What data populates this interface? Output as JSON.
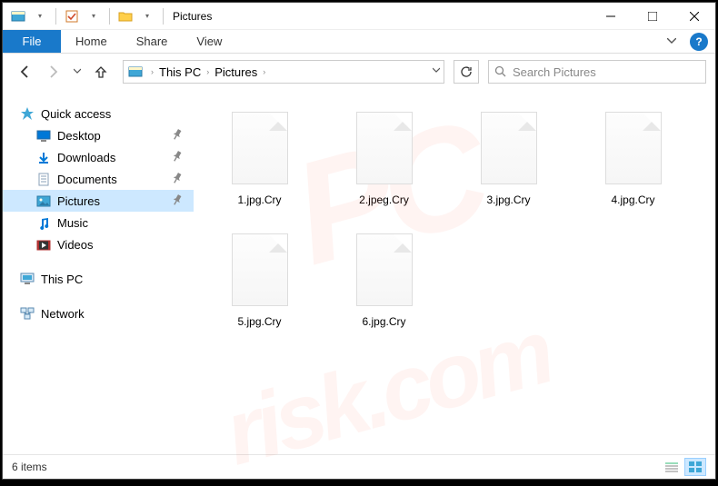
{
  "window": {
    "title": "Pictures",
    "controls": {
      "minimize": "—",
      "maximize": "☐",
      "close": "✕"
    }
  },
  "ribbon": {
    "file": "File",
    "tabs": [
      "Home",
      "Share",
      "View"
    ],
    "help": "?"
  },
  "nav": {
    "back": "←",
    "forward": "→",
    "recent": "˅",
    "up": "↑",
    "address_dropdown": "˅",
    "refresh": "↻"
  },
  "address": {
    "segments": [
      "This PC",
      "Pictures"
    ]
  },
  "search": {
    "placeholder": "Search Pictures"
  },
  "sidebar": {
    "quick_access": {
      "label": "Quick access",
      "items": [
        {
          "label": "Desktop",
          "icon": "desktop",
          "color": "#0078d7",
          "pinned": true
        },
        {
          "label": "Downloads",
          "icon": "downloads",
          "color": "#0078d7",
          "pinned": true
        },
        {
          "label": "Documents",
          "icon": "documents",
          "color": "#8aa0b8",
          "pinned": true
        },
        {
          "label": "Pictures",
          "icon": "pictures",
          "color": "#3fa7d6",
          "pinned": true,
          "selected": true
        },
        {
          "label": "Music",
          "icon": "music",
          "color": "#0078d7",
          "pinned": false
        },
        {
          "label": "Videos",
          "icon": "videos",
          "color": "#b03030",
          "pinned": false
        }
      ]
    },
    "this_pc": {
      "label": "This PC"
    },
    "network": {
      "label": "Network"
    }
  },
  "files": [
    {
      "name": "1.jpg.Cry"
    },
    {
      "name": "2.jpeg.Cry"
    },
    {
      "name": "3.jpg.Cry"
    },
    {
      "name": "4.jpg.Cry"
    },
    {
      "name": "5.jpg.Cry"
    },
    {
      "name": "6.jpg.Cry"
    }
  ],
  "status": {
    "item_count": "6 items",
    "view_mode": "large-icons"
  }
}
